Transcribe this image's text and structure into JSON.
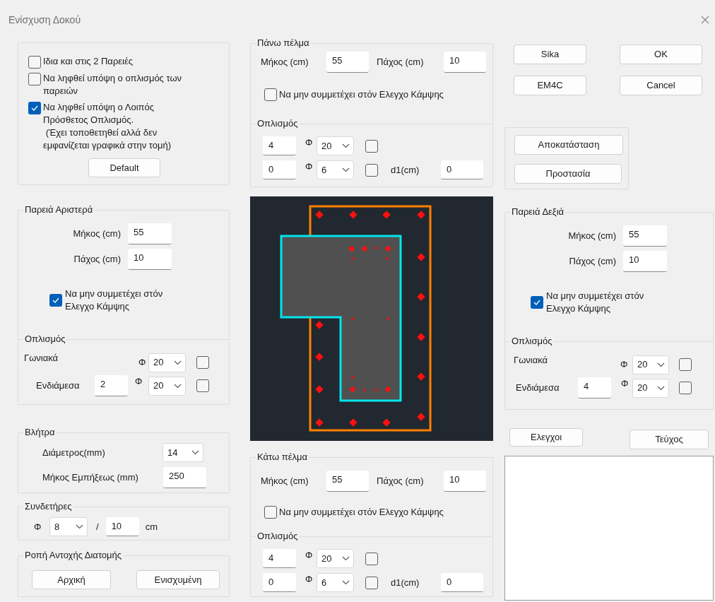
{
  "window": {
    "title": "Ενίσχυση Δοκού"
  },
  "options": {
    "checkboxes": [
      {
        "label": "Ιδια και στις 2 Παρειές",
        "checked": false
      },
      {
        "label": "Να ληφθεί υπόψη ο οπλισμός των\nπαρειών",
        "checked": false
      },
      {
        "label": "Να ληφθεί υπόψη ο Λοιπός\nΠρόσθετος Οπλισμός.\n (Έχει τοποθετηθεί αλλά δεν\nεμφανίζεται γραφικά στην τομή)",
        "checked": true
      }
    ],
    "button": "Default"
  },
  "left_web": {
    "title": "Παρειά Αριστερά",
    "fields": [
      {
        "label": "Μήκος (cm)",
        "value": "55"
      },
      {
        "label": "Πάχος (cm)",
        "value": "10"
      }
    ],
    "exclude": {
      "label": "Να μην συμμετέχει στόν\nΕλεγχο Κάμψης",
      "checked": true
    },
    "reinforcement": {
      "title": "Οπλισμός",
      "rows": [
        {
          "label": "Γωνιακά",
          "phi": "Φ",
          "diameter": "20",
          "checked": false
        },
        {
          "label": "Ενδιάμεσα",
          "count": "2",
          "phi": "Φ",
          "diameter": "20",
          "checked": false
        }
      ]
    }
  },
  "dowels": {
    "title": "Βλήτρα",
    "diameter_label": "Διάμετρος(mm)",
    "diameter": "14",
    "embed_label": "Μήκος Εμπήξεως (mm)",
    "embed": "250"
  },
  "stirrups": {
    "title": "Συνδετήρες",
    "phi": "Φ",
    "diameter": "8",
    "separator": "/",
    "spacing": "10",
    "unit": "cm"
  },
  "moment": {
    "title": "Ροπή Αντοχής Διατομής",
    "buttons": [
      "Αρχική",
      "Ενισχυμένη"
    ]
  },
  "top_flange": {
    "title": "Πάνω πέλμα",
    "fields": [
      {
        "label": "Μήκος (cm)",
        "value": "55"
      },
      {
        "label": "Πάχος (cm)",
        "value": "10"
      }
    ],
    "exclude": {
      "label": "Να μην συμμετέχει στόν Ελεγχο Κάμψης",
      "checked": false
    },
    "reinforcement": {
      "title": "Οπλισμός",
      "rows": [
        {
          "count": "4",
          "phi": "Φ",
          "diameter": "20",
          "checked": false
        },
        {
          "count": "0",
          "phi": "Φ",
          "diameter": "6",
          "checked": false,
          "d1_label": "d1(cm)",
          "d1": "0"
        }
      ]
    }
  },
  "bottom_flange": {
    "title": "Κάτω πέλμα",
    "fields": [
      {
        "label": "Μήκος (cm)",
        "value": "55"
      },
      {
        "label": "Πάχος (cm)",
        "value": "10"
      }
    ],
    "exclude": {
      "label": "Να μην συμμετέχει στόν Ελεγχο Κάμψης",
      "checked": false
    },
    "reinforcement": {
      "title": "Οπλισμός",
      "rows": [
        {
          "count": "4",
          "phi": "Φ",
          "diameter": "20",
          "checked": false
        },
        {
          "count": "0",
          "phi": "Φ",
          "diameter": "6",
          "checked": false,
          "d1_label": "d1(cm)",
          "d1": "0"
        }
      ]
    }
  },
  "actions": {
    "buttons": [
      "Sika",
      "OK",
      "EM4C",
      "Cancel"
    ]
  },
  "restore": {
    "buttons": [
      "Αποκατάσταση",
      "Προστασία"
    ]
  },
  "right_web": {
    "title": "Παρειά Δεξιά",
    "fields": [
      {
        "label": "Μήκος (cm)",
        "value": "55"
      },
      {
        "label": "Πάχος (cm)",
        "value": "10"
      }
    ],
    "exclude": {
      "label": "Να μην συμμετέχει στόν\nΕλεγχο Κάμψης",
      "checked": true
    },
    "reinforcement": {
      "title": "Οπλισμός",
      "rows": [
        {
          "label": "Γωνιακά",
          "phi": "Φ",
          "diameter": "20",
          "checked": false
        },
        {
          "label": "Ενδιάμεσα",
          "count": "4",
          "phi": "Φ",
          "diameter": "20",
          "checked": false
        }
      ]
    }
  },
  "reports": {
    "buttons": [
      "Ελεγχοι",
      "Τεύχος"
    ]
  }
}
